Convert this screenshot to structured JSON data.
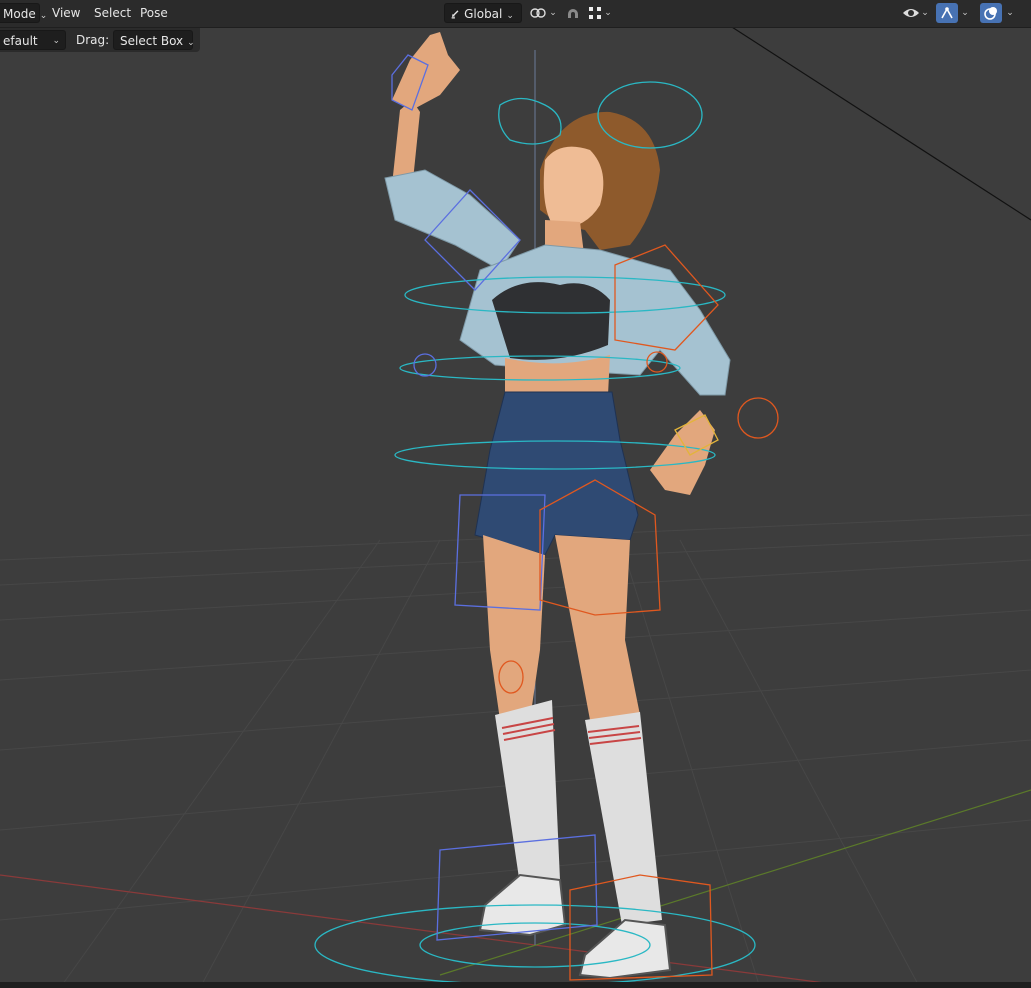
{
  "header": {
    "mode_label": "Mode",
    "menus": [
      "View",
      "Select",
      "Pose"
    ],
    "transform_orientation": "Global"
  },
  "tool_options": {
    "orientation_value": "efault",
    "drag_label": "Drag:",
    "drag_value": "Select Box"
  },
  "icons": {
    "orientation": "transform-orientation-icon",
    "pivot": "pivot-point-icon",
    "snap": "snap-magnet-icon",
    "snap_increment": "snap-increment-icon",
    "visibility": "eye-visibility-icon",
    "gizmo": "gizmo-icon",
    "overlay": "overlay-icon"
  },
  "colors": {
    "viewport_bg": "#3d3d3d",
    "header_bg": "#2b2b2b",
    "active_button": "#4772b3",
    "bone_blue": "#5b6fe0",
    "bone_cyan": "#2ab8c4",
    "bone_orange": "#e0581f",
    "x_axis": "#8a3a3a",
    "y_axis": "#5b7a2a"
  }
}
